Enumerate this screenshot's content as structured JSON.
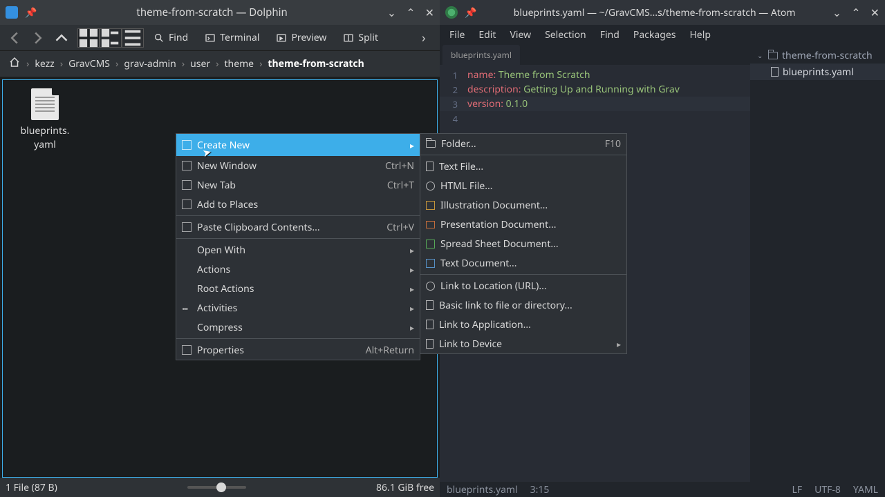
{
  "dolphin": {
    "title": "theme-from-scratch — Dolphin",
    "toolbar": {
      "find": "Find",
      "terminal": "Terminal",
      "preview": "Preview",
      "split": "Split"
    },
    "breadcrumb": [
      "kezz",
      "GravCMS",
      "grav-admin",
      "user",
      "theme",
      "theme-from-scratch"
    ],
    "file": "blueprints.\nyaml",
    "status": {
      "left": "1 File (87 B)",
      "free": "86.1 GiB free"
    },
    "ctx1": [
      {
        "label": "Create New",
        "hl": true,
        "icon": "sq",
        "arrow": true
      },
      {
        "label": "New Window",
        "shortcut": "Ctrl+N",
        "icon": "sq"
      },
      {
        "label": "New Tab",
        "shortcut": "Ctrl+T",
        "icon": "sq"
      },
      {
        "label": "Add to Places",
        "icon": "sq"
      },
      {
        "sep": true
      },
      {
        "label": "Paste Clipboard Contents...",
        "shortcut": "Ctrl+V",
        "icon": "sq"
      },
      {
        "sep": true
      },
      {
        "label": "Open With",
        "icon": "none",
        "arrow": true
      },
      {
        "label": "Actions",
        "icon": "none",
        "arrow": true
      },
      {
        "label": "Root Actions",
        "icon": "none",
        "arrow": true
      },
      {
        "label": "Activities",
        "icon": "dots",
        "arrow": true
      },
      {
        "label": "Compress",
        "icon": "none",
        "arrow": true
      },
      {
        "sep": true
      },
      {
        "label": "Properties",
        "shortcut": "Alt+Return",
        "icon": "sq"
      }
    ],
    "ctx2": [
      {
        "label": "Folder...",
        "shortcut": "F10",
        "icon": "folder"
      },
      {
        "sep": true
      },
      {
        "label": "Text File...",
        "icon": "doc"
      },
      {
        "label": "HTML File...",
        "icon": "globe"
      },
      {
        "label": "Illustration Document...",
        "icon": "ill"
      },
      {
        "label": "Presentation Document...",
        "icon": "pres"
      },
      {
        "label": "Spread Sheet Document...",
        "icon": "sheet"
      },
      {
        "label": "Text Document...",
        "icon": "txt"
      },
      {
        "sep": true
      },
      {
        "label": "Link to Location (URL)...",
        "icon": "globe"
      },
      {
        "label": "Basic link to file or directory...",
        "icon": "doc"
      },
      {
        "label": "Link to Application...",
        "icon": "doc"
      },
      {
        "label": "Link to Device",
        "icon": "doc",
        "arrow": true
      }
    ]
  },
  "atom": {
    "title": "blueprints.yaml — ~/GravCMS...s/theme-from-scratch — Atom",
    "menu": [
      "File",
      "Edit",
      "View",
      "Selection",
      "Find",
      "Packages",
      "Help"
    ],
    "tab": "blueprints.yaml",
    "lines": [
      {
        "n": "1",
        "key": "name:",
        "val": " Theme from Scratch"
      },
      {
        "n": "2",
        "key": "description:",
        "val": " Getting Up and Running with Grav"
      },
      {
        "n": "3",
        "key": "version:",
        "val": " 0.1.0",
        "cur": true
      },
      {
        "n": "4",
        "key": "",
        "val": ""
      }
    ],
    "tree": {
      "root": "theme-from-scratch",
      "file": "blueprints.yaml"
    },
    "status": {
      "file": "blueprints.yaml",
      "pos": "3:15",
      "lf": "LF",
      "enc": "UTF-8",
      "lang": "YAML"
    }
  }
}
